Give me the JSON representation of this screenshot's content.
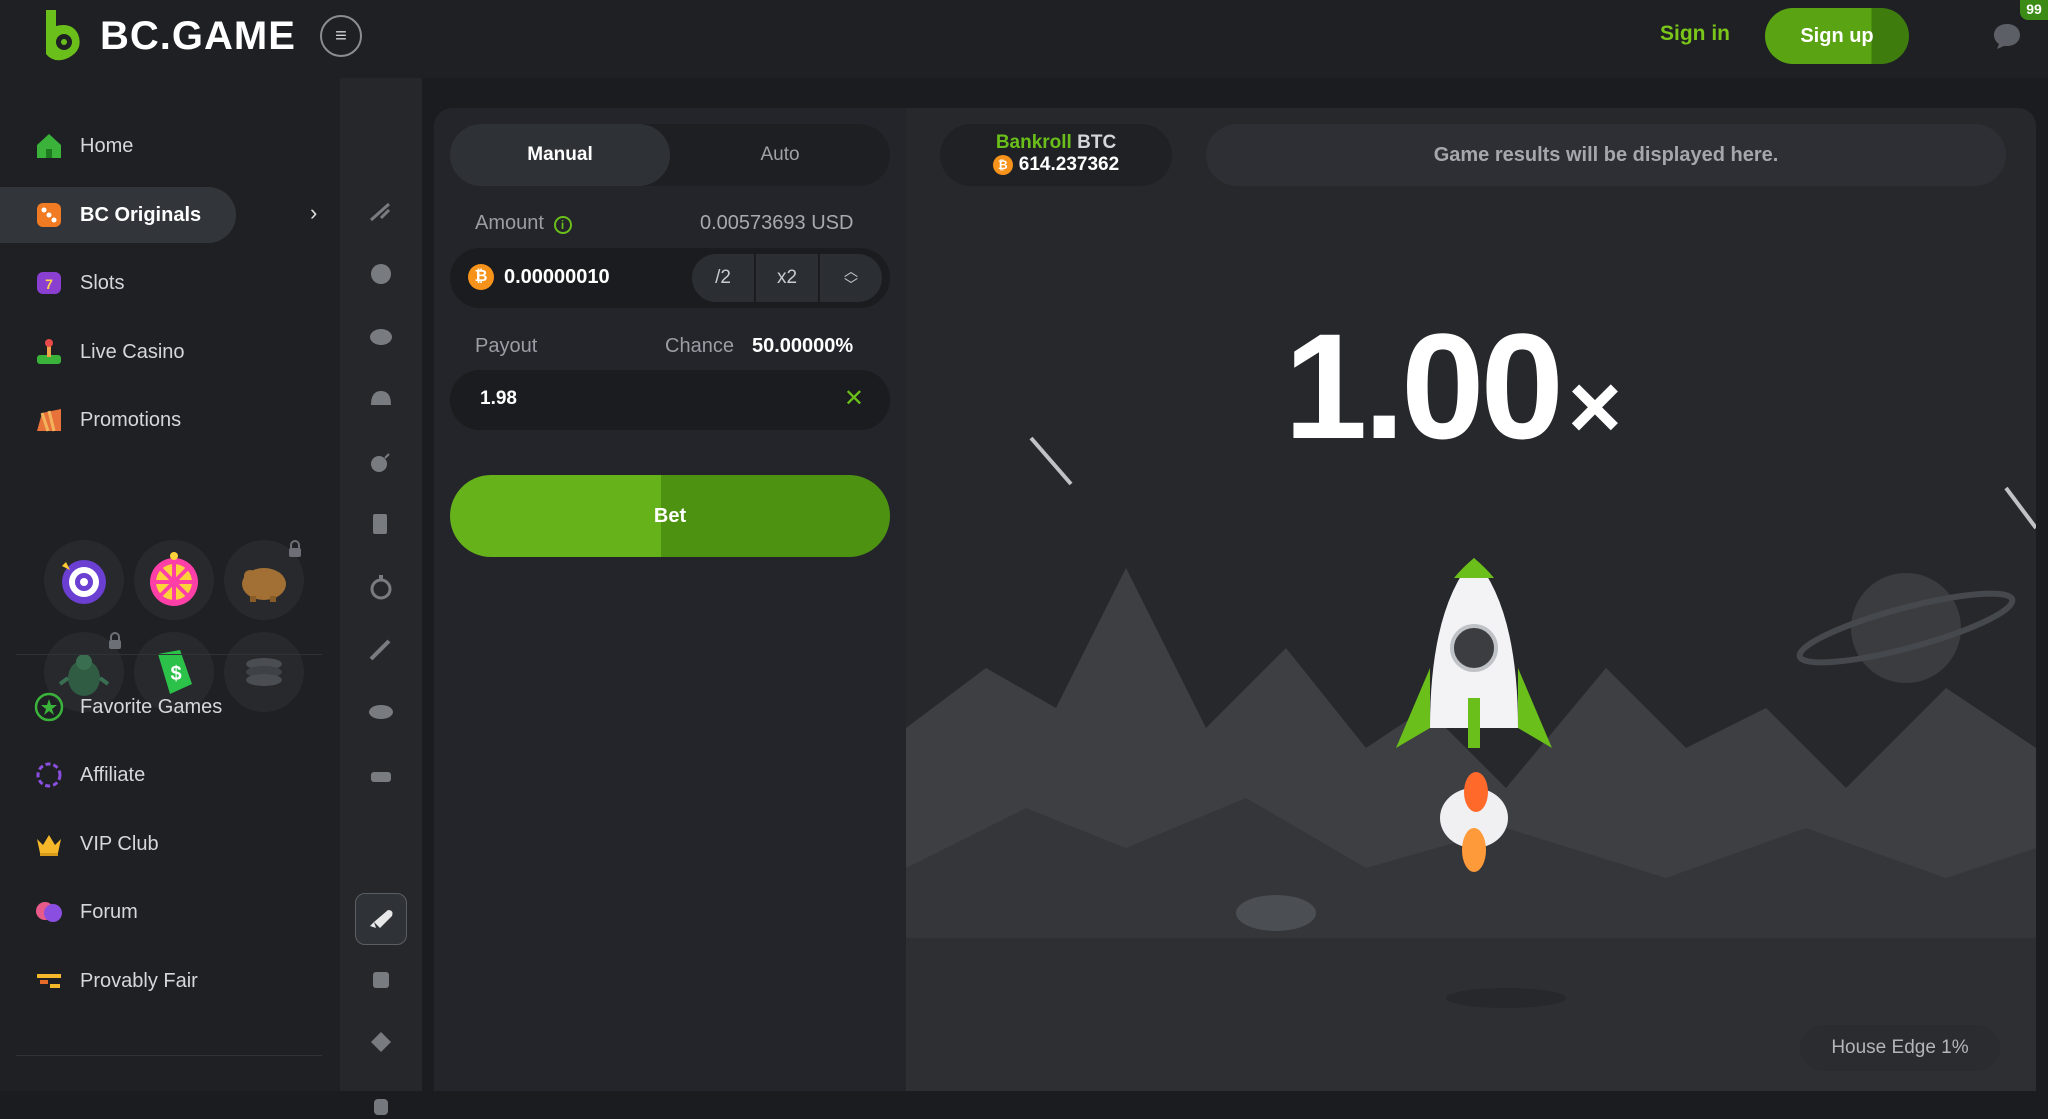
{
  "header": {
    "logo_text": "BC.GAME",
    "sign_in": "Sign in",
    "sign_up": "Sign up",
    "notification_count": "99",
    "icons": [
      "menu-icon",
      "chat-icon"
    ]
  },
  "sidebar": {
    "items": [
      {
        "label": "Home",
        "icon": "home-icon"
      },
      {
        "label": "BC Originals",
        "icon": "dice-icon",
        "active": true
      },
      {
        "label": "Slots",
        "icon": "slot-machine-icon"
      },
      {
        "label": "Live Casino",
        "icon": "joystick-icon"
      },
      {
        "label": "Promotions",
        "icon": "megaphone-icon"
      },
      {
        "label": "Favorite Games",
        "icon": "star-icon"
      },
      {
        "label": "Affiliate",
        "icon": "affiliate-icon"
      },
      {
        "label": "VIP Club",
        "icon": "crown-icon"
      },
      {
        "label": "Forum",
        "icon": "forum-icon"
      },
      {
        "label": "Provably Fair",
        "icon": "scale-icon"
      }
    ],
    "promo_tiles": [
      "target-icon",
      "lucky-wheel-icon",
      "piggy-bank-icon",
      "rocket-bug-icon",
      "money-tag-icon",
      "coin-stack-icon"
    ]
  },
  "bet_panel": {
    "tabs": [
      "Manual",
      "Auto"
    ],
    "amount_label": "Amount",
    "amount_usd": "0.00573693 USD",
    "amount_value": "0.00000010",
    "half_label": "/2",
    "double_label": "x2",
    "payout_label": "Payout",
    "chance_label": "Chance",
    "chance_value": "50.00000%",
    "payout_value": "1.98",
    "bet_label": "Bet"
  },
  "game": {
    "bankroll_label": "Bankroll",
    "bankroll_currency": "BTC",
    "bankroll_value": "614.237362",
    "results_text": "Game results will be displayed here.",
    "multiplier": "1.00",
    "multiplier_suffix": "×",
    "house_edge": "House Edge 1%"
  },
  "colors": {
    "accent_green": "#6abf1a",
    "background": "#1a1c1f",
    "panel": "#23252a",
    "btc_orange": "#f7931a"
  }
}
